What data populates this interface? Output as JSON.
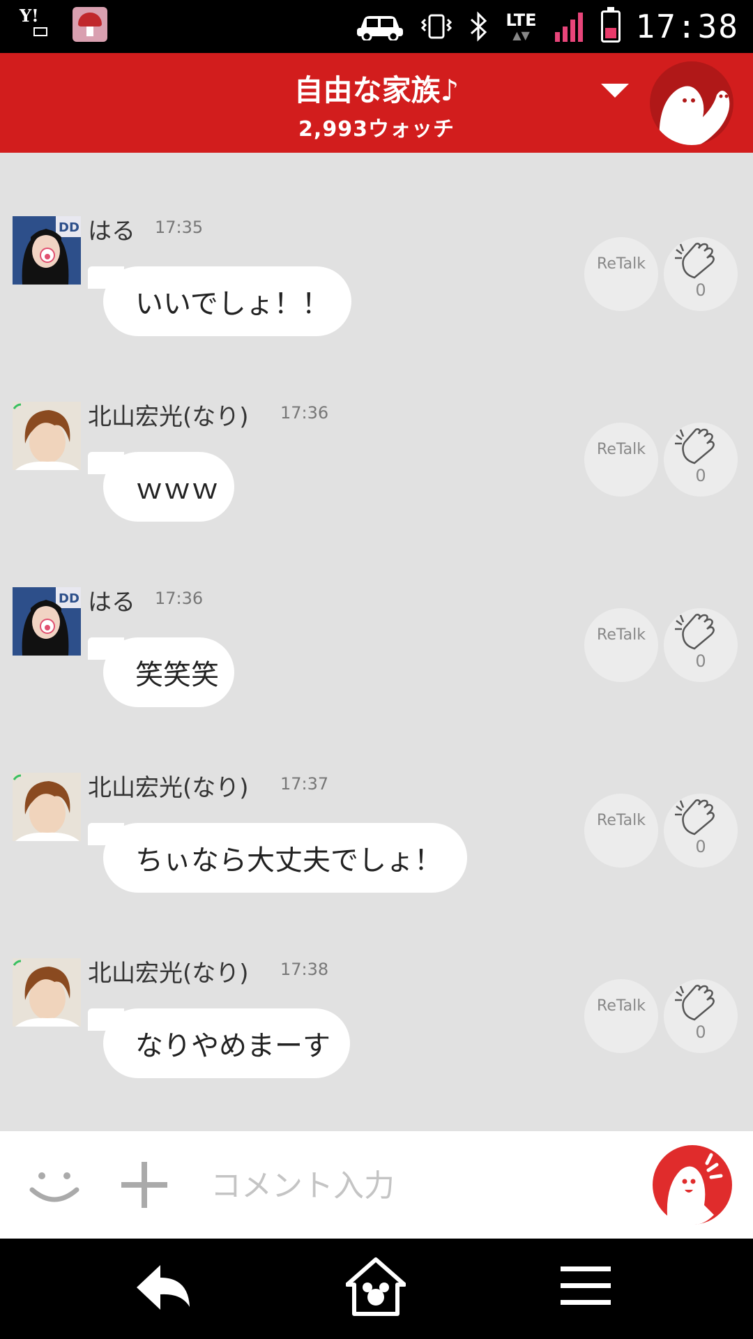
{
  "status_bar": {
    "left_icons": [
      "yahoo-mail-icon",
      "mushroom-app-icon"
    ],
    "right_icons": [
      "car-icon",
      "vibrate-icon",
      "bluetooth-icon",
      "lte-icon",
      "signal-icon",
      "battery-icon"
    ],
    "network": "LTE",
    "time": "17:38"
  },
  "header": {
    "title": "自由な家族♪",
    "watch_count": "2,993ウォッチ",
    "bg_color": "#d21d1d"
  },
  "messages": [
    {
      "user": "はる",
      "time": "17:35",
      "text": "いいでしょ！！",
      "retalk": "ReTalk",
      "claps": "0",
      "avatar": "haru-avatar"
    },
    {
      "user": "北山宏光(なり)",
      "time": "17:36",
      "text": "ｗｗｗ",
      "retalk": "ReTalk",
      "claps": "0",
      "avatar": "kitayama-avatar"
    },
    {
      "user": "はる",
      "time": "17:36",
      "text": "笑笑笑",
      "retalk": "ReTalk",
      "claps": "0",
      "avatar": "haru-avatar"
    },
    {
      "user": "北山宏光(なり)",
      "time": "17:37",
      "text": "ちぃなら大丈夫でしょ！",
      "retalk": "ReTalk",
      "claps": "0",
      "avatar": "kitayama-avatar"
    },
    {
      "user": "北山宏光(なり)",
      "time": "17:38",
      "text": "なりやめまーす",
      "retalk": "ReTalk",
      "claps": "0",
      "avatar": "kitayama-avatar"
    }
  ],
  "input_bar": {
    "placeholder": "コメント入力",
    "icons": [
      "smiley-icon",
      "plus-icon",
      "send-mascot-icon"
    ]
  },
  "nav_bar": {
    "icons": [
      "back-icon",
      "home-icon",
      "menu-icon"
    ]
  }
}
